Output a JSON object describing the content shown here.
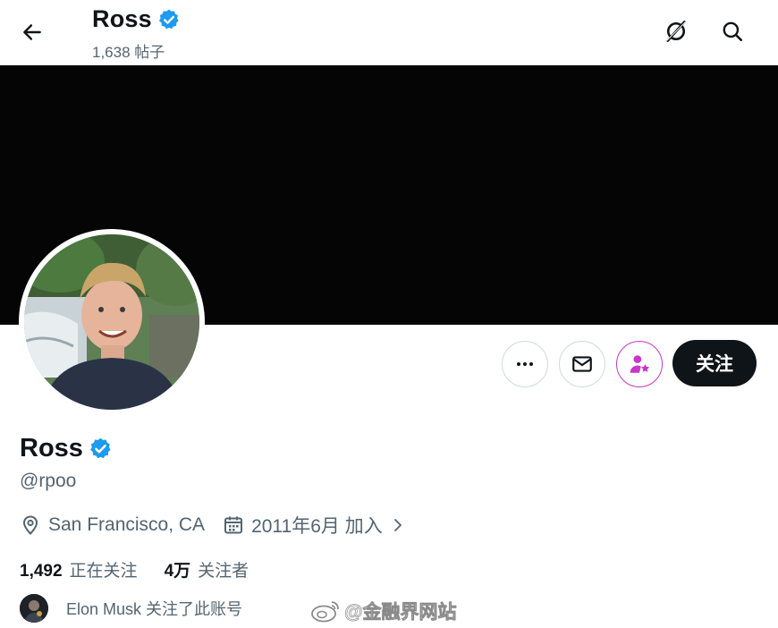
{
  "header": {
    "name": "Ross",
    "post_count": "1,638 帖子",
    "back_icon": "arrow-left-icon",
    "grok_icon": "grok-icon",
    "search_icon": "search-icon"
  },
  "profile": {
    "name": "Ross",
    "handle": "@rpoo",
    "location": "San Francisco, CA",
    "joined": "2011年6月 加入",
    "following_count": "1,492",
    "following_label": "正在关注",
    "followers_count": "4万",
    "followers_label": "关注者",
    "followed_by_text": "Elon Musk 关注了此账号"
  },
  "actions": {
    "follow_label": "关注",
    "more_icon": "more-icon",
    "message_icon": "mail-icon",
    "subscribe_icon": "subscribe-icon"
  },
  "watermark": {
    "text": "@金融界网站"
  },
  "colors": {
    "verified": "#1d9bf0",
    "text_primary": "#0f1419",
    "text_secondary": "#536471",
    "banner": "#050505",
    "subscribe_accent": "#c936c9"
  }
}
